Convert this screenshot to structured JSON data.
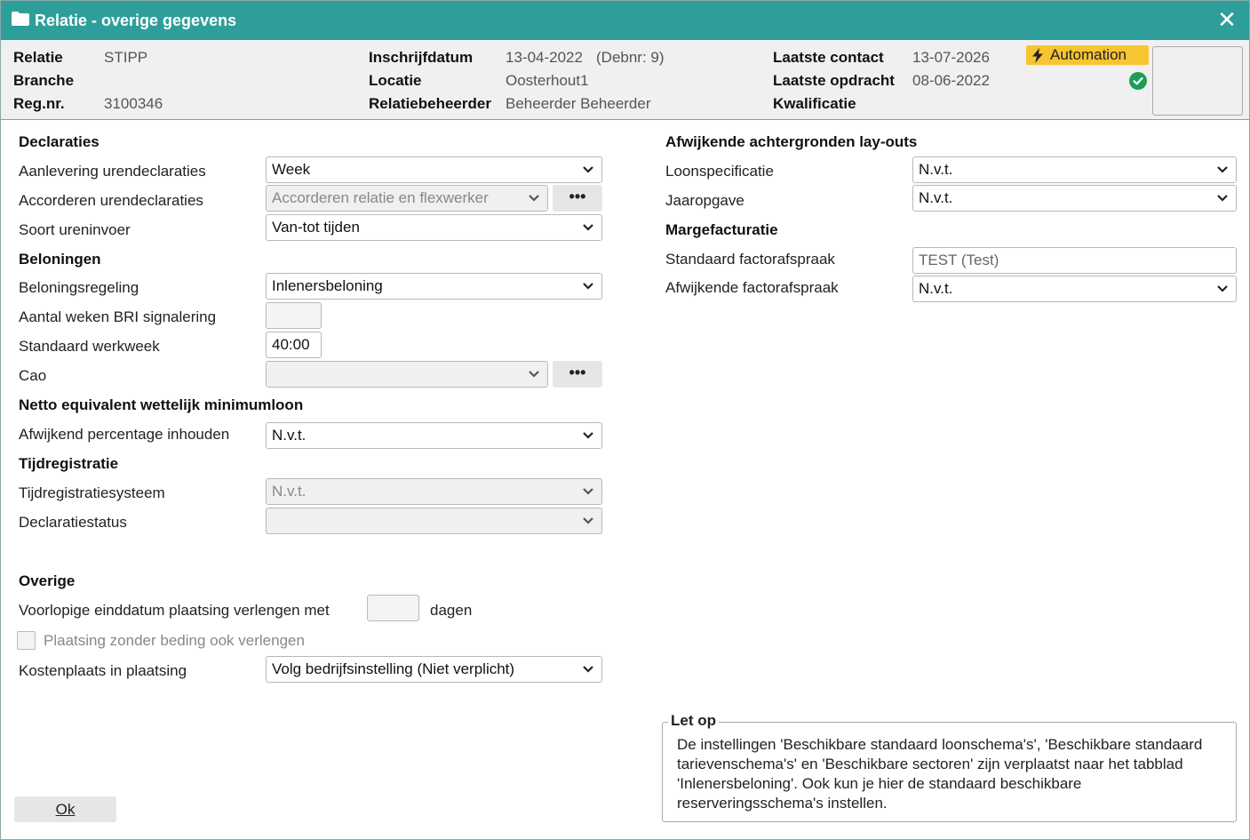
{
  "window": {
    "title": "Relatie - overige gegevens"
  },
  "header": {
    "relatie_label": "Relatie",
    "relatie_value": "STIPP",
    "branche_label": "Branche",
    "branche_value": "",
    "regnr_label": "Reg.nr.",
    "regnr_value": "3100346",
    "inschrijfdatum_label": "Inschrijfdatum",
    "inschrijfdatum_value": "13-04-2022",
    "debnr_value": "(Debnr: 9)",
    "locatie_label": "Locatie",
    "locatie_value": "Oosterhout1",
    "relatiebeheerder_label": "Relatiebeheerder",
    "relatiebeheerder_value": "Beheerder Beheerder",
    "laatste_contact_label": "Laatste contact",
    "laatste_contact_value": "13-07-2026",
    "laatste_opdracht_label": "Laatste opdracht",
    "laatste_opdracht_value": "08-06-2022",
    "kwalificatie_label": "Kwalificatie",
    "badge": "Automation"
  },
  "declaraties": {
    "heading": "Declaraties",
    "aanlevering_label": "Aanlevering urendeclaraties",
    "aanlevering_value": "Week",
    "accorderen_label": "Accorderen urendeclaraties",
    "accorderen_value": "Accorderen relatie en flexwerker",
    "soort_label": "Soort ureninvoer",
    "soort_value": "Van-tot tijden"
  },
  "beloningen": {
    "heading": "Beloningen",
    "regeling_label": "Beloningsregeling",
    "regeling_value": "Inlenersbeloning",
    "bri_label": "Aantal weken BRI signalering",
    "bri_value": "",
    "werkweek_label": "Standaard werkweek",
    "werkweek_value": "40:00",
    "cao_label": "Cao",
    "cao_value": ""
  },
  "netto": {
    "heading": "Netto equivalent wettelijk minimumloon",
    "percentage_label": "Afwijkend percentage inhouden",
    "percentage_value": "N.v.t."
  },
  "tijdregistratie": {
    "heading": "Tijdregistratie",
    "systeem_label": "Tijdregistratiesysteem",
    "systeem_value": "N.v.t.",
    "status_label": "Declaratiestatus",
    "status_value": ""
  },
  "overige": {
    "heading": "Overige",
    "einddatum_label": "Voorlopige einddatum plaatsing verlengen met",
    "einddatum_value": "",
    "dagen_label": "dagen",
    "zonder_beding_label": "Plaatsing zonder beding ook verlengen",
    "kostenplaats_label": "Kostenplaats in plaatsing",
    "kostenplaats_value": "Volg bedrijfsinstelling (Niet verplicht)"
  },
  "layouts": {
    "heading": "Afwijkende achtergronden lay-outs",
    "loonspec_label": "Loonspecificatie",
    "loonspec_value": "N.v.t.",
    "jaaropgave_label": "Jaaropgave",
    "jaaropgave_value": "N.v.t."
  },
  "marge": {
    "heading": "Margefacturatie",
    "standaard_label": "Standaard factorafspraak",
    "standaard_value": "TEST (Test)",
    "afwijkend_label": "Afwijkende factorafspraak",
    "afwijkend_value": "N.v.t."
  },
  "note": {
    "legend": "Let op",
    "text": "De instellingen 'Beschikbare standaard loonschema's', 'Beschikbare standaard tarievenschema's' en 'Beschikbare sectoren' zijn verplaatst naar het tabblad 'Inlenersbeloning'. Ook kun je hier de standaard beschikbare reserveringsschema's instellen."
  },
  "buttons": {
    "ok": "Ok",
    "dots": "•••"
  },
  "colors": {
    "titlebar": "#2e9e9a",
    "badge": "#f7c531",
    "check": "#1e9e55"
  }
}
